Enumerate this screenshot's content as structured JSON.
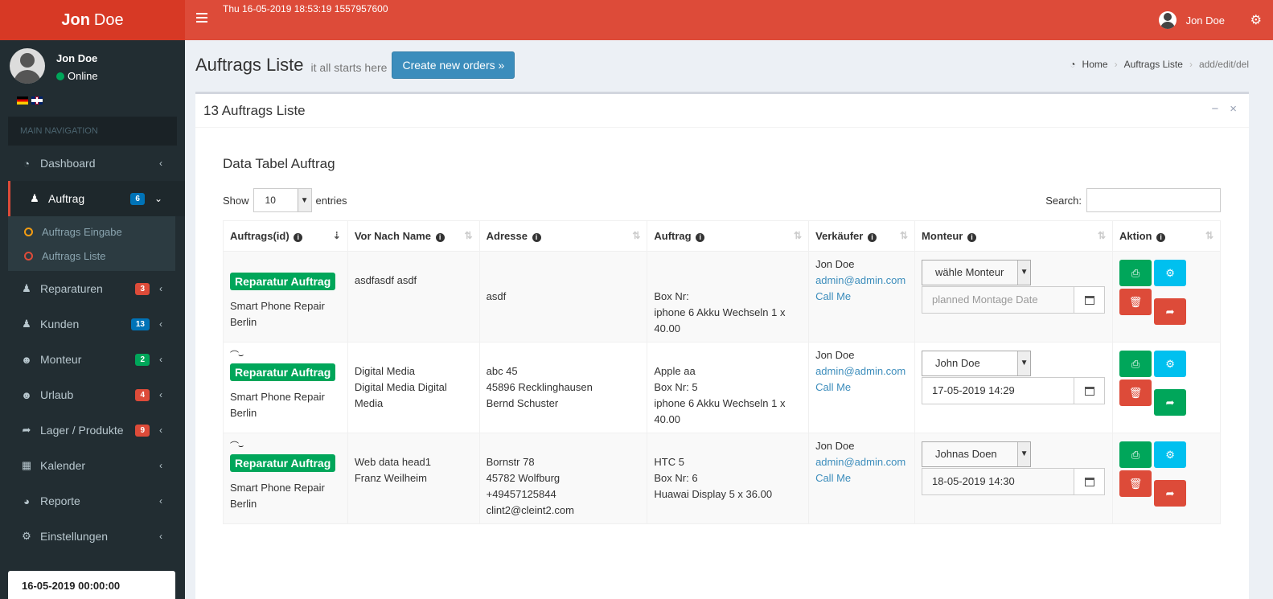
{
  "brand": {
    "first": "Jon",
    "last": "Doe"
  },
  "topbar": {
    "clock": "Thu 16-05-2019 18:53:19 1557957600",
    "user": "Jon Doe"
  },
  "sidebar": {
    "user_name": "Jon Doe",
    "status": "Online",
    "nav_header": "MAIN NAVIGATION",
    "items": [
      {
        "label": "Dashboard",
        "icon": "dashboard-icon",
        "badge": null
      },
      {
        "label": "Auftrag",
        "icon": "male-icon",
        "badge": "6",
        "badge_color": "#0073b7"
      },
      {
        "label": "Reparaturen",
        "icon": "male-icon",
        "badge": "3",
        "badge_color": "#dd4b39"
      },
      {
        "label": "Kunden",
        "icon": "male-icon",
        "badge": "13",
        "badge_color": "#0073b7"
      },
      {
        "label": "Monteur",
        "icon": "users-icon",
        "badge": "2",
        "badge_color": "#00a65a"
      },
      {
        "label": "Urlaub",
        "icon": "users-icon",
        "badge": "4",
        "badge_color": "#dd4b39"
      },
      {
        "label": "Lager / Produkte",
        "icon": "share-icon",
        "badge": "9",
        "badge_color": "#dd4b39"
      },
      {
        "label": "Kalender",
        "icon": "calendar-icon",
        "badge": null
      },
      {
        "label": "Reporte",
        "icon": "pie-chart-icon",
        "badge": null
      },
      {
        "label": "Einstellungen",
        "icon": "cogs-icon",
        "badge": null
      }
    ],
    "sub_items": [
      "Auftrags Eingabe",
      "Auftrags Liste"
    ],
    "date_box": "16-05-2019 00:00:00"
  },
  "header": {
    "title": "Auftrags Liste",
    "subtitle": "it all starts here",
    "create_button": "Create new orders »",
    "breadcrumb": [
      "Home",
      "Auftrags Liste",
      "add/edit/del"
    ]
  },
  "box": {
    "title": "13 Auftrags Liste"
  },
  "datatable": {
    "title": "Data Tabel Auftrag",
    "show_label": "Show",
    "entries_value": "10",
    "entries_label": "entries",
    "search_label": "Search:",
    "columns": [
      "Auftrags(id)",
      "Vor Nach Name",
      "Adresse",
      "Auftrag",
      "Verkäufer",
      "Monteur",
      "Aktion"
    ],
    "rows": [
      {
        "label": "Reparatur Auftrag",
        "shop1": "Smart Phone Repair",
        "shop2": "Berlin",
        "name": [
          "asdfasdf asdf",
          "",
          ""
        ],
        "address": [
          "",
          "asdf",
          "",
          ""
        ],
        "order": [
          "",
          "Box Nr:",
          "iphone 6 Akku Wechseln 1 x",
          "40.00"
        ],
        "seller": "Jon Doe",
        "email": "admin@admin.com",
        "call": "Call Me",
        "monteur": "wähle Monteur",
        "date": "planned Montage Date",
        "fwd_color": "#dd4b39"
      },
      {
        "label": "Reparatur Auftrag",
        "shop1": "Smart Phone Repair",
        "shop2": "Berlin",
        "name": [
          "Digital Media",
          "Digital Media Digital",
          "Media"
        ],
        "address": [
          "abc 45",
          "45896 Recklinghausen",
          "Bernd Schuster",
          ""
        ],
        "order": [
          "Apple aa",
          "Box Nr: 5",
          "iphone 6 Akku Wechseln 1 x",
          "40.00"
        ],
        "seller": "Jon Doe",
        "email": "admin@admin.com",
        "call": "Call Me",
        "monteur": "John Doe",
        "date": "17-05-2019 14:29",
        "fwd_color": "#00a65a"
      },
      {
        "label": "Reparatur Auftrag",
        "shop1": "Smart Phone Repair",
        "shop2": "Berlin",
        "name": [
          "Web data head1",
          "Franz Weilheim",
          ""
        ],
        "address": [
          "Bornstr 78",
          "45782 Wolfburg",
          "+49457125844",
          "clint2@cleint2.com"
        ],
        "order": [
          "HTC 5",
          "Box Nr: 6",
          "Huawai Display 5 x 36.00",
          ""
        ],
        "seller": "Jon Doe",
        "email": "admin@admin.com",
        "call": "Call Me",
        "monteur": "Johnas Doen",
        "date": "18-05-2019 14:30",
        "fwd_color": "#dd4b39"
      }
    ]
  }
}
